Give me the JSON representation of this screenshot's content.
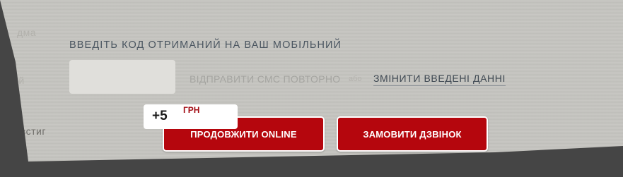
{
  "form": {
    "instruction": "ВВЕДІТЬ КОД ОТРИМАНИЙ НА ВАШ МОБІЛЬНИЙ",
    "code_value": "",
    "resend_label": "ВІДПРАВИТИ СМС ПОВТОРНО",
    "separator": "або",
    "change_label": "ЗМІНИТИ ВВЕДЕНІ ДАННІ"
  },
  "bonus": {
    "amount": "+5",
    "unit": "ГРН"
  },
  "actions": {
    "continue_label": "ПРОДОВЖИТИ ONLINE",
    "call_label": "ЗАМОВИТИ ДЗВІНОК"
  },
  "colors": {
    "accent": "#b5060d",
    "panel": "#c5c4bf",
    "backdrop": "#454545"
  }
}
